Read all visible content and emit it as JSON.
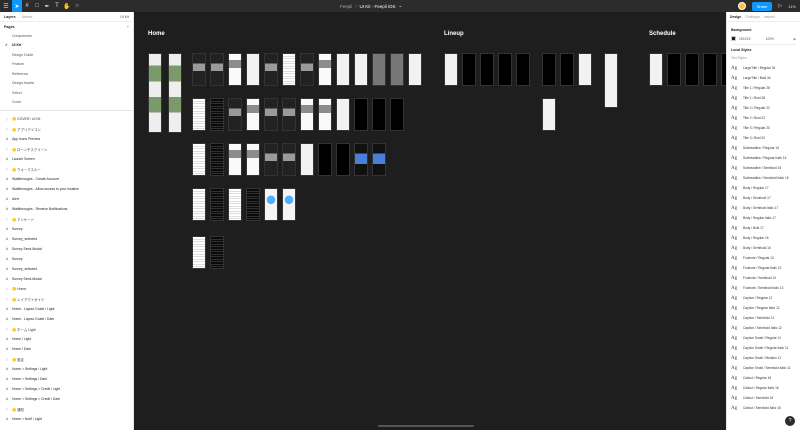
{
  "toolbar": {
    "project": "Feepli",
    "separator": "/",
    "file_name": "UI Kit - Feepli iOS",
    "chevron": "⌄",
    "share_label": "Share",
    "zoom": "11%"
  },
  "left_panel": {
    "tabs": [
      "Layers",
      "Assets"
    ],
    "page_switch": "UI Kit",
    "pages_title": "Pages",
    "pages": [
      {
        "label": "Components",
        "current": false
      },
      {
        "label": "UI Kit",
        "current": true
      },
      {
        "label": "Design Guide",
        "current": false
      },
      {
        "label": "Feature",
        "current": false
      },
      {
        "label": "Reference",
        "current": false
      },
      {
        "label": "Design Assets",
        "current": false
      },
      {
        "label": "Select",
        "current": false
      },
      {
        "label": "Cover",
        "current": false
      }
    ],
    "layers": [
      {
        "label": "🟡 COVER / UI Kit",
        "type": "section"
      },
      {
        "label": "🟡 アプリアイコン",
        "type": "section"
      },
      {
        "label": "App Icons Preview",
        "type": "frame"
      },
      {
        "label": "🟡 ローンチスクリーン",
        "type": "section"
      },
      {
        "label": "Launch Screen",
        "type": "frame"
      },
      {
        "label": "🟡 ウォークスルー",
        "type": "section"
      },
      {
        "label": "Walkthroughs - Create Account",
        "type": "frame"
      },
      {
        "label": "Walkthroughs - Allow access to your location",
        "type": "frame"
      },
      {
        "label": "Alert",
        "type": "frame"
      },
      {
        "label": "Walkthroughs - Receive Notifications",
        "type": "frame"
      },
      {
        "label": "🟡 アンケート",
        "type": "section"
      },
      {
        "label": "Survey",
        "type": "frame"
      },
      {
        "label": "Survey_selected",
        "type": "frame"
      },
      {
        "label": "Survey Semi-Modal",
        "type": "frame"
      },
      {
        "label": "Survey",
        "type": "frame"
      },
      {
        "label": "Survey_selected",
        "type": "frame"
      },
      {
        "label": "Survey Semi-Modal",
        "type": "frame"
      },
      {
        "label": "🟡 Home",
        "type": "section"
      },
      {
        "label": "🟡 レイアウトガイド",
        "type": "section"
      },
      {
        "label": "Home - Layout Guide / Light",
        "type": "frame"
      },
      {
        "label": "Home - Layout Guide / Dark",
        "type": "frame"
      },
      {
        "label": "🟡 ホーム Light",
        "type": "section"
      },
      {
        "label": "Home / Light",
        "type": "frame"
      },
      {
        "label": "Home / Dark",
        "type": "frame"
      },
      {
        "label": "🟡 設定",
        "type": "section"
      },
      {
        "label": "Home > Settings / Light",
        "type": "frame"
      },
      {
        "label": "Home > Settings / Dark",
        "type": "frame"
      },
      {
        "label": "Home > Settings > Credit / Light",
        "type": "frame"
      },
      {
        "label": "Home > Settings > Credit / Dark",
        "type": "frame"
      },
      {
        "label": "🟡 通知",
        "type": "section"
      },
      {
        "label": "Home > Notif / Light",
        "type": "frame"
      }
    ]
  },
  "canvas": {
    "sections": [
      "Home",
      "Lineup",
      "Schedule"
    ]
  },
  "right_panel": {
    "tabs": [
      "Design",
      "Prototype",
      "Inspect"
    ],
    "background_title": "Background",
    "background_hex": "1E1E1E",
    "background_opacity": "100%",
    "local_styles_title": "Local Styles",
    "text_styles_label": "Text Styles",
    "text_styles": [
      "LargeTitle / Regular 34",
      "LargeTitle / Bold 34",
      "Title 1 / Regular 28",
      "Title 1 / Bold 28",
      "Title 2 / Regular 22",
      "Title 2 / Bold 22",
      "Title 3 / Regular 20",
      "Title 3 / Bold 20",
      "Subheadline / Regular 15",
      "Subheadline / Regular Italic 15",
      "Subheadline / Semibold 15",
      "Subheadline / Semibold Italic 15",
      "Body / Regular 17",
      "Body / Semibold 17",
      "Body / Semibold Italic 17",
      "Body / Regular Italic 17",
      "Body / Bold 17",
      "Body / Regular 16",
      "Body / Semibold 16",
      "Footnote / Regular 13",
      "Footnote / Regular Italic 13",
      "Footnote / Semibold 13",
      "Footnote / Semibold Italic 13",
      "Caption / Regular 12",
      "Caption / Regular Italic 12",
      "Caption / Semibold 12",
      "Caption / Semibold Italic 12",
      "Caption Small / Regular 11",
      "Caption Small / Regular Italic 11",
      "Caption Small / Medium 11",
      "Caption Small / Semibold Italic 11",
      "Callout / Regular 16",
      "Callout / Regular Italic 16",
      "Callout / Semibold 16",
      "Callout / Semibold Italic 16"
    ]
  },
  "help_label": "?"
}
